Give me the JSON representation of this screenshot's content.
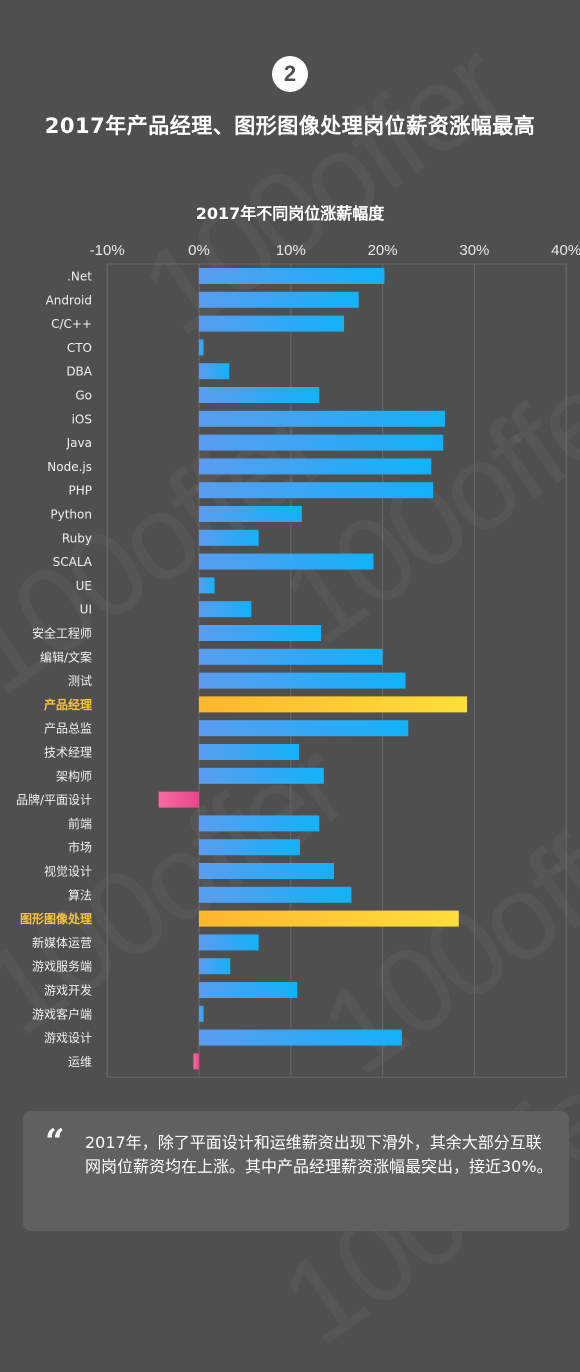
{
  "badge": {
    "number": "2"
  },
  "header": {
    "title": "2017年产品经理、图形图像处理岗位薪资涨幅最高"
  },
  "watermark": {
    "text": "100offer"
  },
  "colors": {
    "background": "#4f4f4f",
    "bar_positive_start": "#5a9cf0",
    "bar_positive_end": "#12b2f8",
    "bar_highlight_start": "#ffb62e",
    "bar_highlight_end": "#ffde3a",
    "bar_negative_start": "#f76aa3",
    "bar_negative_end": "#e8478a",
    "highlight_label": "#f5c33b"
  },
  "chart_data": {
    "type": "bar",
    "orientation": "horizontal",
    "title": "2017年不同岗位涨薪幅度",
    "xlabel": "",
    "ylabel": "",
    "xlim": [
      -10,
      40
    ],
    "x_ticks": [
      -10,
      0,
      10,
      20,
      30,
      40
    ],
    "x_tick_labels": [
      "-10%",
      "0%",
      "10%",
      "20%",
      "30%",
      "40%"
    ],
    "tick_position": "top",
    "grid": true,
    "legend": "none",
    "unit": "%",
    "categories": [
      ".Net",
      "Android",
      "C/C++",
      "CTO",
      "DBA",
      "Go",
      "iOS",
      "Java",
      "Node.js",
      "PHP",
      "Python",
      "Ruby",
      "SCALA",
      "UE",
      "UI",
      "安全工程师",
      "编辑/文案",
      "测试",
      "产品经理",
      "产品总监",
      "技术经理",
      "架构师",
      "品牌/平面设计",
      "前端",
      "市场",
      "视觉设计",
      "算法",
      "图形图像处理",
      "新媒体运营",
      "游戏服务端",
      "游戏开发",
      "游戏客户端",
      "游戏设计",
      "运维"
    ],
    "values": [
      20.2,
      17.4,
      15.8,
      0.5,
      3.3,
      13.1,
      26.8,
      26.6,
      25.3,
      25.5,
      11.2,
      6.5,
      19.0,
      1.7,
      5.7,
      13.3,
      20.0,
      22.5,
      29.2,
      22.8,
      10.9,
      13.6,
      -4.4,
      13.1,
      11.0,
      14.7,
      16.6,
      28.3,
      6.5,
      3.4,
      10.7,
      0.5,
      22.1,
      -0.6
    ],
    "highlighted": [
      "产品经理",
      "图形图像处理"
    ]
  },
  "quote": {
    "icon": "quote-icon",
    "mark": "“",
    "text": "2017年，除了平面设计和运维薪资出现下滑外，其余大部分互联网岗位薪资均在上涨。其中产品经理薪资涨幅最突出，接近30%。"
  }
}
